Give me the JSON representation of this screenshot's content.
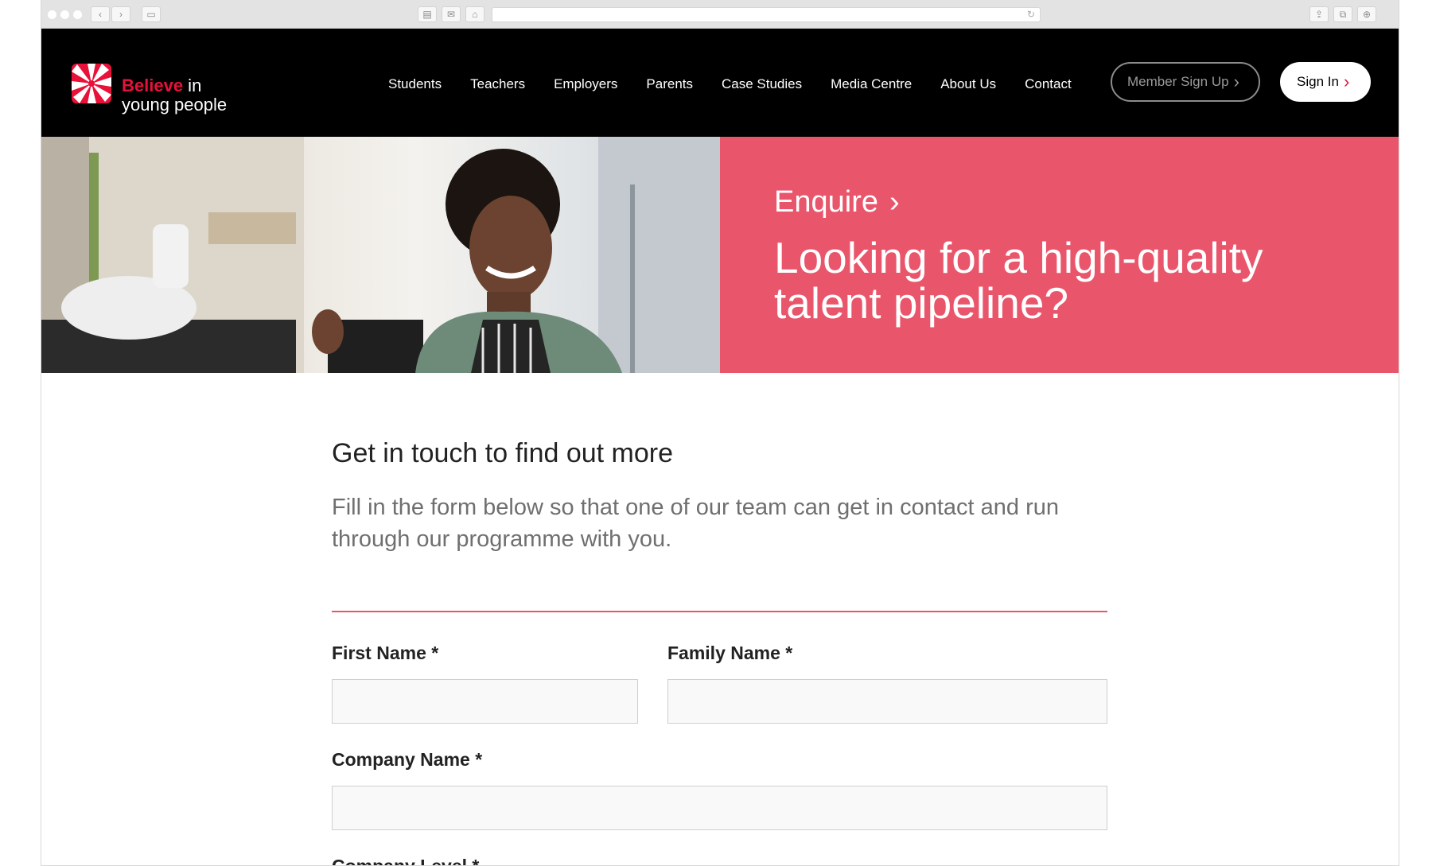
{
  "brand": {
    "accent": "#e8113a",
    "hero_bg": "#e9566b",
    "logo_word1": "Believe",
    "logo_word2": " in",
    "logo_line2": "young people",
    "logo_icon": "sunburst-logo-icon"
  },
  "nav": {
    "items": [
      "Students",
      "Teachers",
      "Employers",
      "Parents",
      "Case Studies",
      "Media Centre",
      "About Us",
      "Contact"
    ],
    "member_button": "Member Sign Up",
    "signin_button": "Sign In"
  },
  "hero": {
    "breadcrumb": "Enquire",
    "title": "Looking for a high-quality talent pipeline?",
    "photo": "woman-barista-photo"
  },
  "form_intro": {
    "title": "Get in touch to find out more",
    "text": "Fill in the form below so that one of our team can get in contact and run through our programme with you."
  },
  "form": {
    "first_name_label": "First Name *",
    "family_name_label": "Family Name *",
    "company_name_label": "Company Name *",
    "company_level_label": "Company Level *",
    "first_name_value": "",
    "family_name_value": "",
    "company_name_value": ""
  }
}
